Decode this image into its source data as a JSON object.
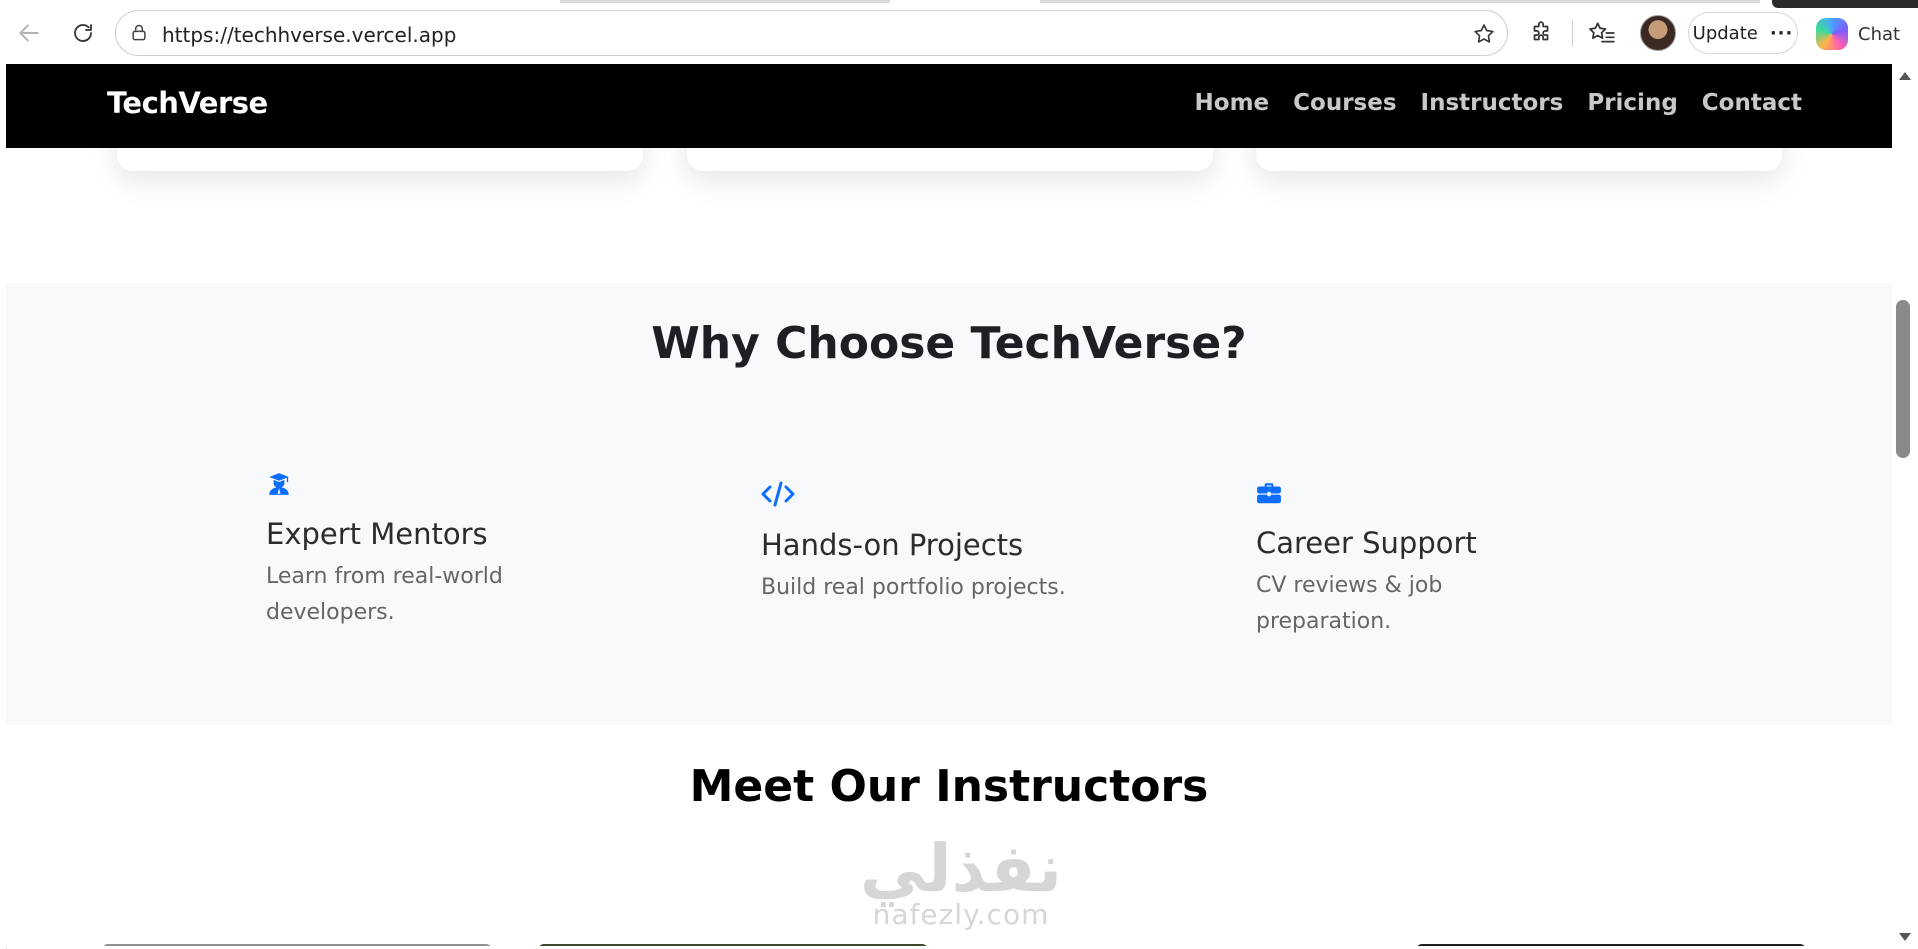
{
  "browser": {
    "url": "https://techhverse.vercel.app",
    "update_label": "Update",
    "more_label": "···",
    "chat_label": "Chat"
  },
  "site": {
    "brand": "TechVerse",
    "nav": [
      "Home",
      "Courses",
      "Instructors",
      "Pricing",
      "Contact"
    ],
    "accent_color": "#0d6efd"
  },
  "features": {
    "title": "Why Choose TechVerse?",
    "items": [
      {
        "icon": "graduation-user-icon",
        "title": "Expert Mentors",
        "desc": "Learn from real-world developers."
      },
      {
        "icon": "code-icon",
        "title": "Hands-on Projects",
        "desc": "Build real portfolio projects."
      },
      {
        "icon": "briefcase-icon",
        "title": "Career Support",
        "desc": "CV reviews & job preparation."
      }
    ]
  },
  "instructors": {
    "title": "Meet Our Instructors"
  },
  "watermark": {
    "arabic": "نفذلي",
    "latin": "nafezly.com"
  }
}
